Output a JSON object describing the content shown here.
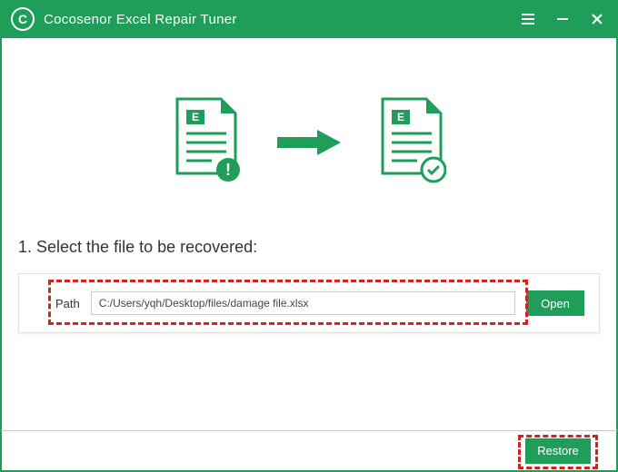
{
  "app": {
    "title": "Cocosenor Excel Repair Tuner",
    "logo_letter": "C"
  },
  "step": {
    "label": "1. Select the file to be recovered:",
    "path_label": "Path",
    "path_value": "C:/Users/yqh/Desktop/files/damage file.xlsx",
    "open_label": "Open"
  },
  "footer": {
    "restore_label": "Restore"
  },
  "icons": {
    "excel_letter": "E"
  },
  "colors": {
    "primary": "#1f9e5a",
    "highlight": "#d92020"
  }
}
